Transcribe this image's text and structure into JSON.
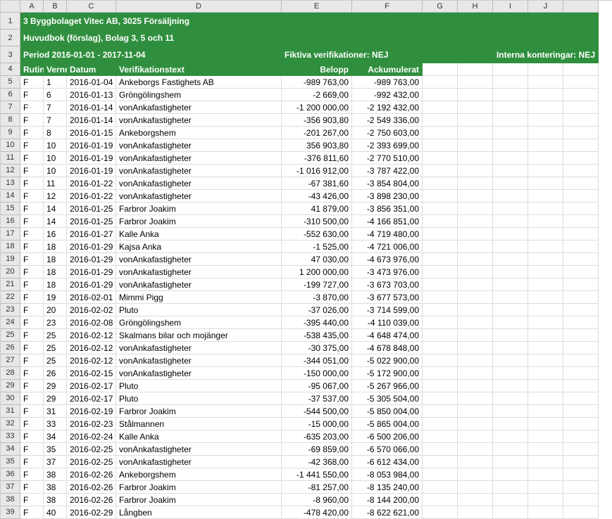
{
  "columns": [
    "A",
    "B",
    "C",
    "D",
    "E",
    "F",
    "G",
    "H",
    "I",
    "J"
  ],
  "header": {
    "title": "3 Byggbolaget Vitec AB, 3025 Försäljning",
    "subtitle": "Huvudbok (förslag), Bolag 3, 5 och 11",
    "period": "Period 2016-01-01 - 2017-11-04",
    "fiktiva": "Fiktiva verifikationer: NEJ",
    "interna": "Interna konteringar: NEJ",
    "cols": {
      "rutin": "Rutin",
      "vernr": "Vernr",
      "datum": "Datum",
      "vtext": "Verifikationstext",
      "belopp": "Belopp",
      "ack": "Ackumulerat"
    }
  },
  "rows": [
    {
      "n": 5,
      "r": "F",
      "v": "1",
      "d": "2016-01-04",
      "t": "Ankeborgs Fastighets AB",
      "b": "-989 763,00",
      "a": "-989 763,00"
    },
    {
      "n": 6,
      "r": "F",
      "v": "6",
      "d": "2016-01-13",
      "t": "Gröngölingshem",
      "b": "-2 669,00",
      "a": "-992 432,00"
    },
    {
      "n": 7,
      "r": "F",
      "v": "7",
      "d": "2016-01-14",
      "t": "vonAnkafastigheter",
      "b": "-1 200 000,00",
      "a": "-2 192 432,00"
    },
    {
      "n": 8,
      "r": "F",
      "v": "7",
      "d": "2016-01-14",
      "t": "vonAnkafastigheter",
      "b": "-356 903,80",
      "a": "-2 549 336,00"
    },
    {
      "n": 9,
      "r": "F",
      "v": "8",
      "d": "2016-01-15",
      "t": "Ankeborgshem",
      "b": "-201 267,00",
      "a": "-2 750 603,00"
    },
    {
      "n": 10,
      "r": "F",
      "v": "10",
      "d": "2016-01-19",
      "t": "vonAnkafastigheter",
      "b": "356 903,80",
      "a": "-2 393 699,00"
    },
    {
      "n": 11,
      "r": "F",
      "v": "10",
      "d": "2016-01-19",
      "t": "vonAnkafastigheter",
      "b": "-376 811,60",
      "a": "-2 770 510,00"
    },
    {
      "n": 12,
      "r": "F",
      "v": "10",
      "d": "2016-01-19",
      "t": "vonAnkafastigheter",
      "b": "-1 016 912,00",
      "a": "-3 787 422,00"
    },
    {
      "n": 13,
      "r": "F",
      "v": "11",
      "d": "2016-01-22",
      "t": "vonAnkafastigheter",
      "b": "-67 381,60",
      "a": "-3 854 804,00"
    },
    {
      "n": 14,
      "r": "F",
      "v": "12",
      "d": "2016-01-22",
      "t": "vonAnkafastigheter",
      "b": "-43 426,00",
      "a": "-3 898 230,00"
    },
    {
      "n": 15,
      "r": "F",
      "v": "14",
      "d": "2016-01-25",
      "t": "Farbror Joakim",
      "b": "41 879,00",
      "a": "-3 856 351,00"
    },
    {
      "n": 16,
      "r": "F",
      "v": "14",
      "d": "2016-01-25",
      "t": "Farbror Joakim",
      "b": "-310 500,00",
      "a": "-4 166 851,00"
    },
    {
      "n": 17,
      "r": "F",
      "v": "16",
      "d": "2016-01-27",
      "t": "Kalle Anka",
      "b": "-552 630,00",
      "a": "-4 719 480,00"
    },
    {
      "n": 18,
      "r": "F",
      "v": "18",
      "d": "2016-01-29",
      "t": "Kajsa Anka",
      "b": "-1 525,00",
      "a": "-4 721 006,00"
    },
    {
      "n": 19,
      "r": "F",
      "v": "18",
      "d": "2016-01-29",
      "t": "vonAnkafastigheter",
      "b": "47 030,00",
      "a": "-4 673 976,00"
    },
    {
      "n": 20,
      "r": "F",
      "v": "18",
      "d": "2016-01-29",
      "t": "vonAnkafastigheter",
      "b": "1 200 000,00",
      "a": "-3 473 976,00"
    },
    {
      "n": 21,
      "r": "F",
      "v": "18",
      "d": "2016-01-29",
      "t": "vonAnkafastigheter",
      "b": "-199 727,00",
      "a": "-3 673 703,00"
    },
    {
      "n": 22,
      "r": "F",
      "v": "19",
      "d": "2016-02-01",
      "t": "Mimmi Pigg",
      "b": "-3 870,00",
      "a": "-3 677 573,00"
    },
    {
      "n": 23,
      "r": "F",
      "v": "20",
      "d": "2016-02-02",
      "t": "Pluto",
      "b": "-37 026,00",
      "a": "-3 714 599,00"
    },
    {
      "n": 24,
      "r": "F",
      "v": "23",
      "d": "2016-02-08",
      "t": "Gröngölingshem",
      "b": "-395 440,00",
      "a": "-4 110 039,00"
    },
    {
      "n": 25,
      "r": "F",
      "v": "25",
      "d": "2016-02-12",
      "t": "Skalmans bilar och mojänger",
      "b": "-538 435,00",
      "a": "-4 648 474,00"
    },
    {
      "n": 26,
      "r": "F",
      "v": "25",
      "d": "2016-02-12",
      "t": "vonAnkafastigheter",
      "b": "-30 375,00",
      "a": "-4 678 848,00"
    },
    {
      "n": 27,
      "r": "F",
      "v": "25",
      "d": "2016-02-12",
      "t": "vonAnkafastigheter",
      "b": "-344 051,00",
      "a": "-5 022 900,00"
    },
    {
      "n": 28,
      "r": "F",
      "v": "26",
      "d": "2016-02-15",
      "t": "vonAnkafastigheter",
      "b": "-150 000,00",
      "a": "-5 172 900,00"
    },
    {
      "n": 29,
      "r": "F",
      "v": "29",
      "d": "2016-02-17",
      "t": "Pluto",
      "b": "-95 067,00",
      "a": "-5 267 966,00"
    },
    {
      "n": 30,
      "r": "F",
      "v": "29",
      "d": "2016-02-17",
      "t": "Pluto",
      "b": "-37 537,00",
      "a": "-5 305 504,00"
    },
    {
      "n": 31,
      "r": "F",
      "v": "31",
      "d": "2016-02-19",
      "t": "Farbror Joakim",
      "b": "-544 500,00",
      "a": "-5 850 004,00"
    },
    {
      "n": 32,
      "r": "F",
      "v": "33",
      "d": "2016-02-23",
      "t": "Stålmannen",
      "b": "-15 000,00",
      "a": "-5 865 004,00"
    },
    {
      "n": 33,
      "r": "F",
      "v": "34",
      "d": "2016-02-24",
      "t": "Kalle Anka",
      "b": "-635 203,00",
      "a": "-6 500 206,00"
    },
    {
      "n": 34,
      "r": "F",
      "v": "35",
      "d": "2016-02-25",
      "t": "vonAnkafastigheter",
      "b": "-69 859,00",
      "a": "-6 570 066,00"
    },
    {
      "n": 35,
      "r": "F",
      "v": "37",
      "d": "2016-02-25",
      "t": "vonAnkafastigheter",
      "b": "-42 368,00",
      "a": "-6 612 434,00"
    },
    {
      "n": 36,
      "r": "F",
      "v": "38",
      "d": "2016-02-26",
      "t": "Ankeborgshem",
      "b": "-1 441 550,00",
      "a": "-8 053 984,00"
    },
    {
      "n": 37,
      "r": "F",
      "v": "38",
      "d": "2016-02-26",
      "t": "Farbror Joakim",
      "b": "-81 257,00",
      "a": "-8 135 240,00"
    },
    {
      "n": 38,
      "r": "F",
      "v": "38",
      "d": "2016-02-26",
      "t": "Farbror Joakim",
      "b": "-8 960,00",
      "a": "-8 144 200,00"
    },
    {
      "n": 39,
      "r": "F",
      "v": "40",
      "d": "2016-02-29",
      "t": "Långben",
      "b": "-478 420,00",
      "a": "-8 622 621,00"
    }
  ]
}
